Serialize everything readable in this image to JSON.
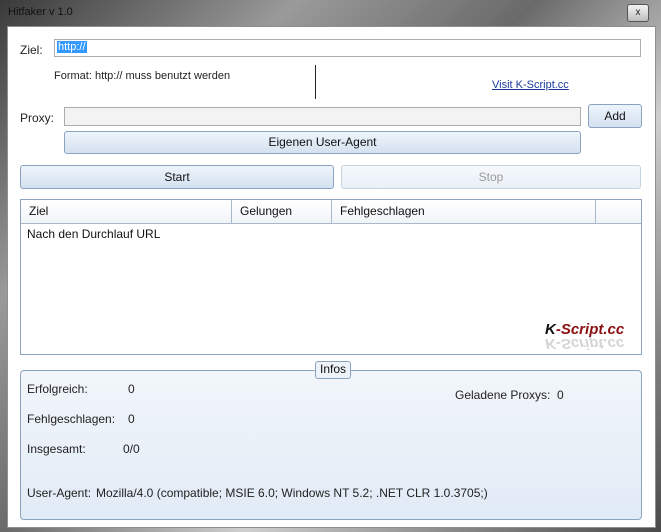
{
  "window": {
    "title": "Hitfaker v 1.0",
    "close_glyph": "x"
  },
  "target": {
    "label": "Ziel:",
    "value": "http://",
    "format_hint": "Format: http:// muss benutzt werden",
    "visit_link": "Visit K-Script.cc"
  },
  "proxy": {
    "label": "Proxy:",
    "value": "",
    "add_label": "Add",
    "useragent_button": "Eigenen User-Agent"
  },
  "controls": {
    "start_label": "Start",
    "stop_label": "Stop"
  },
  "list": {
    "columns": [
      "Ziel",
      "Gelungen",
      "Fehlgeschlagen"
    ],
    "rows": [
      {
        "ziel": "Nach den Durchlauf URL",
        "gelungen": "",
        "fehlgeschlagen": ""
      }
    ],
    "logo_k": "K",
    "logo_rest": "-Script.cc"
  },
  "infos": {
    "legend": "Infos",
    "erfolgreich_label": "Erfolgreich:",
    "erfolgreich_value": "0",
    "fehlgeschlagen_label": "Fehlgeschlagen:",
    "fehlgeschlagen_value": "0",
    "insgesamt_label": "Insgesamt:",
    "insgesamt_value": "0/0",
    "proxys_label": "Geladene Proxys:",
    "proxys_value": "0",
    "useragent_label": "User-Agent:",
    "useragent_value": "Mozilla/4.0 (compatible; MSIE 6.0; Windows NT 5.2; .NET CLR 1.0.3705;)"
  }
}
